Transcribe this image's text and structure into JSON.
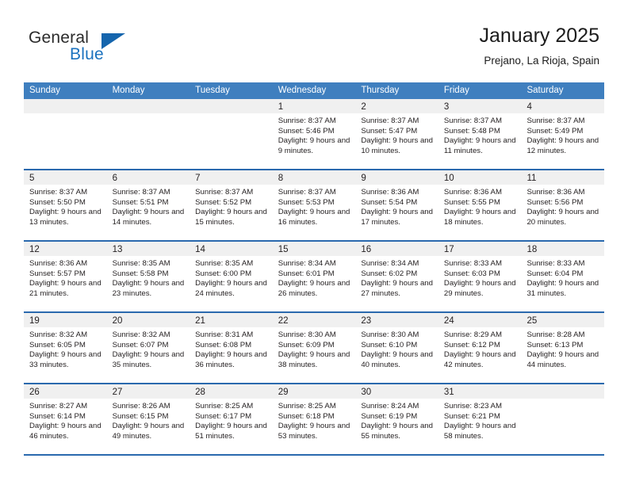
{
  "logo": {
    "word_top": "General",
    "word_bottom": "Blue",
    "triangle_color": "#1565ad",
    "blue_text_color": "#1b72bf"
  },
  "header": {
    "title": "January 2025",
    "subtitle": "Prejano, La Rioja, Spain"
  },
  "theme": {
    "header_row_bg": "#3f7fbf",
    "week_separator": "#2a69ae",
    "day_band_bg": "#f0f0f0",
    "text": "#231f20"
  },
  "calendar": {
    "weekdays": [
      "Sunday",
      "Monday",
      "Tuesday",
      "Wednesday",
      "Thursday",
      "Friday",
      "Saturday"
    ],
    "weeks": [
      [
        {
          "day": "",
          "lines": []
        },
        {
          "day": "",
          "lines": []
        },
        {
          "day": "",
          "lines": []
        },
        {
          "day": "1",
          "lines": [
            "Sunrise: 8:37 AM",
            "Sunset: 5:46 PM",
            "Daylight: 9 hours and 9 minutes."
          ]
        },
        {
          "day": "2",
          "lines": [
            "Sunrise: 8:37 AM",
            "Sunset: 5:47 PM",
            "Daylight: 9 hours and 10 minutes."
          ]
        },
        {
          "day": "3",
          "lines": [
            "Sunrise: 8:37 AM",
            "Sunset: 5:48 PM",
            "Daylight: 9 hours and 11 minutes."
          ]
        },
        {
          "day": "4",
          "lines": [
            "Sunrise: 8:37 AM",
            "Sunset: 5:49 PM",
            "Daylight: 9 hours and 12 minutes."
          ]
        }
      ],
      [
        {
          "day": "5",
          "lines": [
            "Sunrise: 8:37 AM",
            "Sunset: 5:50 PM",
            "Daylight: 9 hours and 13 minutes."
          ]
        },
        {
          "day": "6",
          "lines": [
            "Sunrise: 8:37 AM",
            "Sunset: 5:51 PM",
            "Daylight: 9 hours and 14 minutes."
          ]
        },
        {
          "day": "7",
          "lines": [
            "Sunrise: 8:37 AM",
            "Sunset: 5:52 PM",
            "Daylight: 9 hours and 15 minutes."
          ]
        },
        {
          "day": "8",
          "lines": [
            "Sunrise: 8:37 AM",
            "Sunset: 5:53 PM",
            "Daylight: 9 hours and 16 minutes."
          ]
        },
        {
          "day": "9",
          "lines": [
            "Sunrise: 8:36 AM",
            "Sunset: 5:54 PM",
            "Daylight: 9 hours and 17 minutes."
          ]
        },
        {
          "day": "10",
          "lines": [
            "Sunrise: 8:36 AM",
            "Sunset: 5:55 PM",
            "Daylight: 9 hours and 18 minutes."
          ]
        },
        {
          "day": "11",
          "lines": [
            "Sunrise: 8:36 AM",
            "Sunset: 5:56 PM",
            "Daylight: 9 hours and 20 minutes."
          ]
        }
      ],
      [
        {
          "day": "12",
          "lines": [
            "Sunrise: 8:36 AM",
            "Sunset: 5:57 PM",
            "Daylight: 9 hours and 21 minutes."
          ]
        },
        {
          "day": "13",
          "lines": [
            "Sunrise: 8:35 AM",
            "Sunset: 5:58 PM",
            "Daylight: 9 hours and 23 minutes."
          ]
        },
        {
          "day": "14",
          "lines": [
            "Sunrise: 8:35 AM",
            "Sunset: 6:00 PM",
            "Daylight: 9 hours and 24 minutes."
          ]
        },
        {
          "day": "15",
          "lines": [
            "Sunrise: 8:34 AM",
            "Sunset: 6:01 PM",
            "Daylight: 9 hours and 26 minutes."
          ]
        },
        {
          "day": "16",
          "lines": [
            "Sunrise: 8:34 AM",
            "Sunset: 6:02 PM",
            "Daylight: 9 hours and 27 minutes."
          ]
        },
        {
          "day": "17",
          "lines": [
            "Sunrise: 8:33 AM",
            "Sunset: 6:03 PM",
            "Daylight: 9 hours and 29 minutes."
          ]
        },
        {
          "day": "18",
          "lines": [
            "Sunrise: 8:33 AM",
            "Sunset: 6:04 PM",
            "Daylight: 9 hours and 31 minutes."
          ]
        }
      ],
      [
        {
          "day": "19",
          "lines": [
            "Sunrise: 8:32 AM",
            "Sunset: 6:05 PM",
            "Daylight: 9 hours and 33 minutes."
          ]
        },
        {
          "day": "20",
          "lines": [
            "Sunrise: 8:32 AM",
            "Sunset: 6:07 PM",
            "Daylight: 9 hours and 35 minutes."
          ]
        },
        {
          "day": "21",
          "lines": [
            "Sunrise: 8:31 AM",
            "Sunset: 6:08 PM",
            "Daylight: 9 hours and 36 minutes."
          ]
        },
        {
          "day": "22",
          "lines": [
            "Sunrise: 8:30 AM",
            "Sunset: 6:09 PM",
            "Daylight: 9 hours and 38 minutes."
          ]
        },
        {
          "day": "23",
          "lines": [
            "Sunrise: 8:30 AM",
            "Sunset: 6:10 PM",
            "Daylight: 9 hours and 40 minutes."
          ]
        },
        {
          "day": "24",
          "lines": [
            "Sunrise: 8:29 AM",
            "Sunset: 6:12 PM",
            "Daylight: 9 hours and 42 minutes."
          ]
        },
        {
          "day": "25",
          "lines": [
            "Sunrise: 8:28 AM",
            "Sunset: 6:13 PM",
            "Daylight: 9 hours and 44 minutes."
          ]
        }
      ],
      [
        {
          "day": "26",
          "lines": [
            "Sunrise: 8:27 AM",
            "Sunset: 6:14 PM",
            "Daylight: 9 hours and 46 minutes."
          ]
        },
        {
          "day": "27",
          "lines": [
            "Sunrise: 8:26 AM",
            "Sunset: 6:15 PM",
            "Daylight: 9 hours and 49 minutes."
          ]
        },
        {
          "day": "28",
          "lines": [
            "Sunrise: 8:25 AM",
            "Sunset: 6:17 PM",
            "Daylight: 9 hours and 51 minutes."
          ]
        },
        {
          "day": "29",
          "lines": [
            "Sunrise: 8:25 AM",
            "Sunset: 6:18 PM",
            "Daylight: 9 hours and 53 minutes."
          ]
        },
        {
          "day": "30",
          "lines": [
            "Sunrise: 8:24 AM",
            "Sunset: 6:19 PM",
            "Daylight: 9 hours and 55 minutes."
          ]
        },
        {
          "day": "31",
          "lines": [
            "Sunrise: 8:23 AM",
            "Sunset: 6:21 PM",
            "Daylight: 9 hours and 58 minutes."
          ]
        },
        {
          "day": "",
          "lines": []
        }
      ]
    ]
  }
}
